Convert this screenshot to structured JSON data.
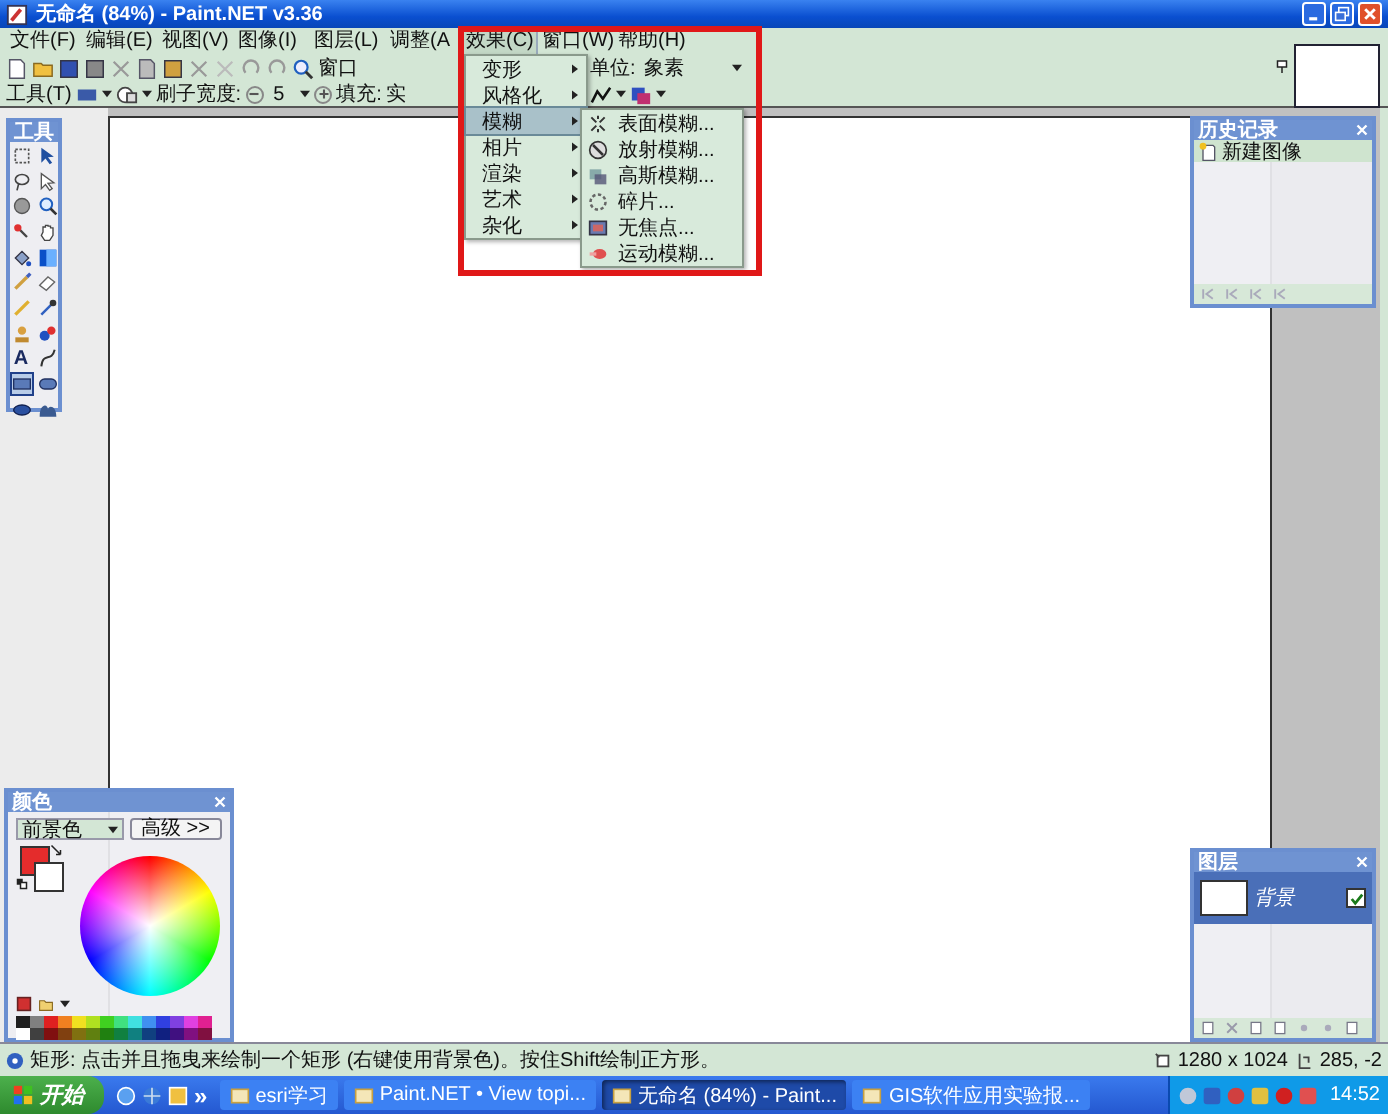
{
  "window": {
    "title": "无命名 (84%) - Paint.NET v3.36"
  },
  "menu_bar": [
    {
      "label": "文件(F)",
      "open": false
    },
    {
      "label": "编辑(E)",
      "open": false
    },
    {
      "label": "视图(V)",
      "open": false
    },
    {
      "label": "图像(I)",
      "open": false
    },
    {
      "label": "图层(L)",
      "open": false
    },
    {
      "label": "调整(A",
      "open": false
    },
    {
      "label": "效果(C)",
      "open": true
    },
    {
      "label": "窗口(W)",
      "open": false
    },
    {
      "label": "帮助(H)",
      "open": false
    }
  ],
  "effects_menu": [
    {
      "label": "变形",
      "selected": false
    },
    {
      "label": "风格化",
      "selected": false
    },
    {
      "label": "模糊",
      "selected": true
    },
    {
      "label": "相片",
      "selected": false
    },
    {
      "label": "渲染",
      "selected": false
    },
    {
      "label": "艺术",
      "selected": false
    },
    {
      "label": "杂化",
      "selected": false
    }
  ],
  "blur_submenu": [
    "表面模糊...",
    "放射模糊...",
    "高斯模糊...",
    "碎片...",
    "无焦点...",
    "运动模糊..."
  ],
  "toolbar": {
    "cut_text": "窗口",
    "units_label": "单位:",
    "units_value": "象素"
  },
  "tool_options": {
    "tool_label": "工具(T)",
    "brush_width_label": "刷子宽度:",
    "brush_width_value": "5",
    "fill_label": "填充:",
    "fill_value": "实"
  },
  "tools_panel": {
    "title": "工具",
    "tools": [
      {
        "kind": "rectangle-select",
        "selected": false
      },
      {
        "kind": "move-selected",
        "selected": false
      },
      {
        "kind": "lasso",
        "selected": false
      },
      {
        "kind": "move-selection",
        "selected": false
      },
      {
        "kind": "ellipse-select",
        "selected": false
      },
      {
        "kind": "zoom",
        "selected": false
      },
      {
        "kind": "magic-wand",
        "selected": false
      },
      {
        "kind": "pan",
        "selected": false
      },
      {
        "kind": "paint-bucket",
        "selected": false
      },
      {
        "kind": "gradient",
        "selected": false
      },
      {
        "kind": "paintbrush",
        "selected": false
      },
      {
        "kind": "eraser",
        "selected": false
      },
      {
        "kind": "pencil",
        "selected": false
      },
      {
        "kind": "color-picker",
        "selected": false
      },
      {
        "kind": "clone-stamp",
        "selected": false
      },
      {
        "kind": "recolor",
        "selected": false
      },
      {
        "kind": "text",
        "glyph": "A",
        "selected": false
      },
      {
        "kind": "line",
        "selected": false
      },
      {
        "kind": "rectangle",
        "selected": true
      },
      {
        "kind": "rounded-rectangle",
        "selected": false
      },
      {
        "kind": "ellipse",
        "selected": false
      },
      {
        "kind": "freeform",
        "selected": false
      }
    ]
  },
  "history_panel": {
    "title": "历史记录",
    "items": [
      {
        "label": "新建图像",
        "selected": true
      }
    ]
  },
  "colors_panel": {
    "title": "颜色",
    "mode": "前景色",
    "more_button": "高级 >>",
    "current_colors": [
      {
        "color": "#e42c2c"
      },
      {
        "color": "#ffffff"
      }
    ],
    "palette": [
      {
        "color": "#202020"
      },
      {
        "color": "#808080"
      },
      {
        "color": "#e02020"
      },
      {
        "color": "#f08020"
      },
      {
        "color": "#f0e020"
      },
      {
        "color": "#b0e020"
      },
      {
        "color": "#40d020"
      },
      {
        "color": "#40e080"
      },
      {
        "color": "#40e0e0"
      },
      {
        "color": "#4090f0"
      },
      {
        "color": "#3040e0"
      },
      {
        "color": "#8040e0"
      },
      {
        "color": "#e040e0"
      },
      {
        "color": "#e02090"
      },
      {
        "color": "#ffffff"
      },
      {
        "color": "#404040"
      },
      {
        "color": "#801010"
      },
      {
        "color": "#804010"
      },
      {
        "color": "#807010"
      },
      {
        "color": "#608010"
      },
      {
        "color": "#208010"
      },
      {
        "color": "#108040"
      },
      {
        "color": "#108080"
      },
      {
        "color": "#104080"
      },
      {
        "color": "#102080"
      },
      {
        "color": "#401080"
      },
      {
        "color": "#801080"
      },
      {
        "color": "#801040"
      }
    ]
  },
  "layers_panel": {
    "title": "图层",
    "layers": [
      {
        "name": "背景",
        "selected": true,
        "visible": true
      }
    ]
  },
  "status_bar": {
    "hint": "矩形: 点击并且拖曳来绘制一个矩形 (右键使用背景色)。按住Shift绘制正方形。",
    "image_size": "1280 x 1024",
    "cursor_position": "285, -2"
  },
  "taskbar": {
    "start": "开始",
    "more": "»",
    "tasks": [
      {
        "label": "esri学习",
        "selected": false
      },
      {
        "label": "Paint.NET • View topi...",
        "selected": false
      },
      {
        "label": "无命名 (84%) - Paint...",
        "selected": true
      },
      {
        "label": "GIS软件应用实验报...",
        "selected": false
      }
    ],
    "clock": "14:52"
  }
}
